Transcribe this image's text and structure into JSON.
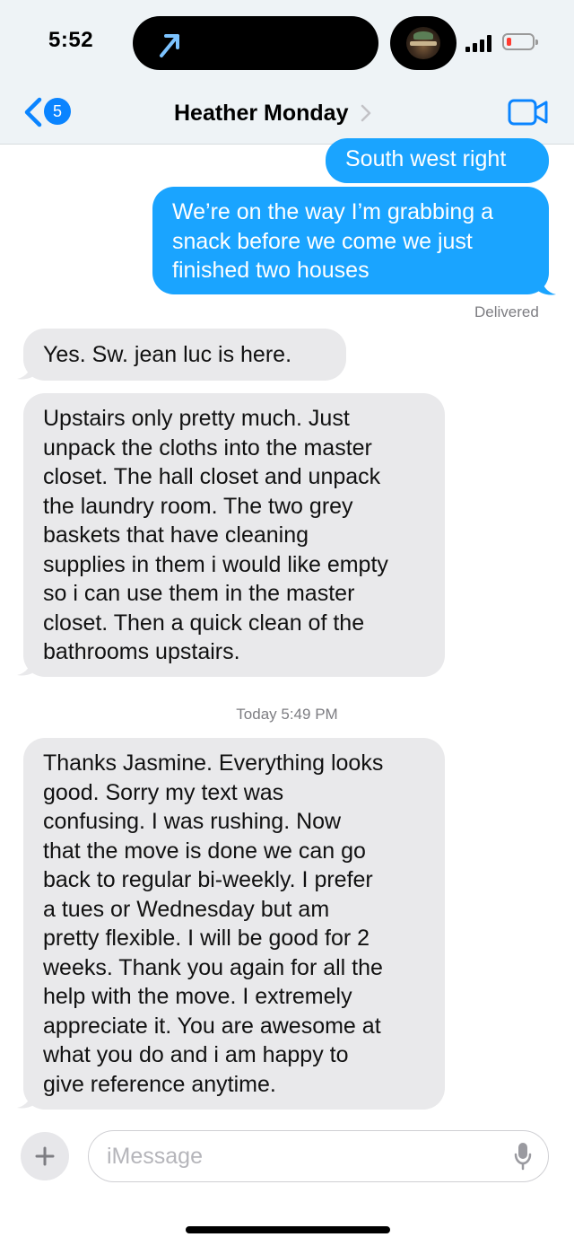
{
  "status_bar": {
    "time": "5:52",
    "battery_level": 0.1,
    "signal_bars": 4
  },
  "header": {
    "back_badge": "5",
    "contact_name": "Heather Monday"
  },
  "messages": [
    {
      "side": "sent",
      "text": "South west right"
    },
    {
      "side": "sent",
      "text": "We’re on the way I’m grabbing a\nsnack before we come we just\nfinished two houses",
      "status": "Delivered"
    },
    {
      "side": "received",
      "text": "Yes.  Sw.  jean luc is here."
    },
    {
      "side": "received",
      "text": "Upstairs only pretty much.  Just\nunpack the cloths into the master\ncloset.  The hall closet and unpack\nthe laundry room.  The two grey\nbaskets that have cleaning\nsupplies in them i would like empty\nso i can use them in the master\ncloset.  Then a quick clean of the\nbathrooms upstairs."
    },
    {
      "side": "received",
      "timestamp": "Today 5:49 PM",
      "text": "Thanks Jasmine.  Everything looks\ngood.  Sorry my text was\nconfusing.  I was rushing.  Now\nthat the move is done we can go\nback to regular bi-weekly.  I prefer\na tues or Wednesday but am\npretty flexible.  I will be good for 2\nweeks.  Thank you again for all the\nhelp with the move.  I extremely\nappreciate it.  You are awesome at\nwhat you do and i am happy to\ngive reference anytime."
    }
  ],
  "compose": {
    "placeholder": "iMessage"
  },
  "colors": {
    "sent_bubble": "#1aa4ff",
    "received_bubble": "#e9e9eb",
    "accent": "#0a84ff",
    "header_bg": "#eef3f6"
  },
  "icons": [
    "location-arrow-icon",
    "back-chevron-icon",
    "chevron-right-icon",
    "video-camera-icon",
    "plus-icon",
    "microphone-icon",
    "signal-icon",
    "battery-icon"
  ]
}
